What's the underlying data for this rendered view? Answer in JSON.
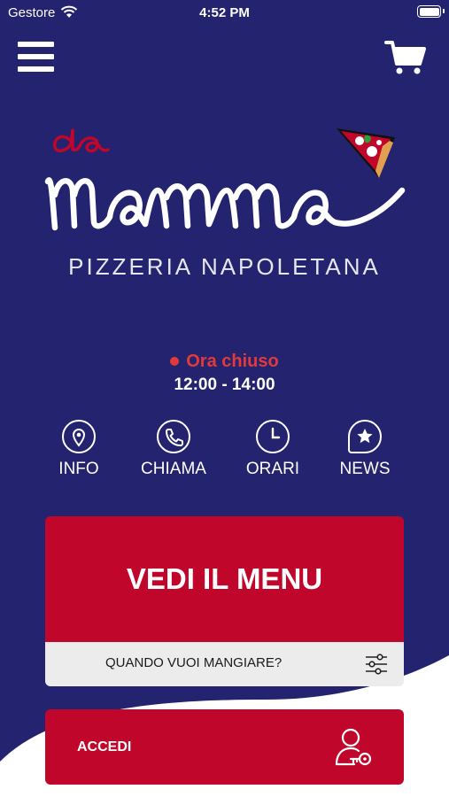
{
  "status_bar": {
    "carrier": "Gestore",
    "time": "4:52 PM"
  },
  "brand": {
    "logo_text_top": "da",
    "logo_text_main": "mamma",
    "subtitle": "PIZZERIA NAPOLETANA"
  },
  "opening": {
    "status": "Ora chiuso",
    "hours": "12:00 - 14:00"
  },
  "actions": [
    {
      "label": "INFO",
      "icon": "location-pin-icon"
    },
    {
      "label": "CHIAMA",
      "icon": "phone-icon"
    },
    {
      "label": "ORARI",
      "icon": "clock-icon"
    },
    {
      "label": "NEWS",
      "icon": "star-speech-icon"
    }
  ],
  "menu": {
    "cta": "VEDI IL MENU",
    "when_prompt": "QUANDO VUOI MANGIARE?"
  },
  "login": {
    "label": "ACCEDI"
  },
  "colors": {
    "background": "#23236f",
    "accent_red": "#c0062a",
    "status_red": "#e23a3a",
    "bar_gray": "#ececec"
  }
}
